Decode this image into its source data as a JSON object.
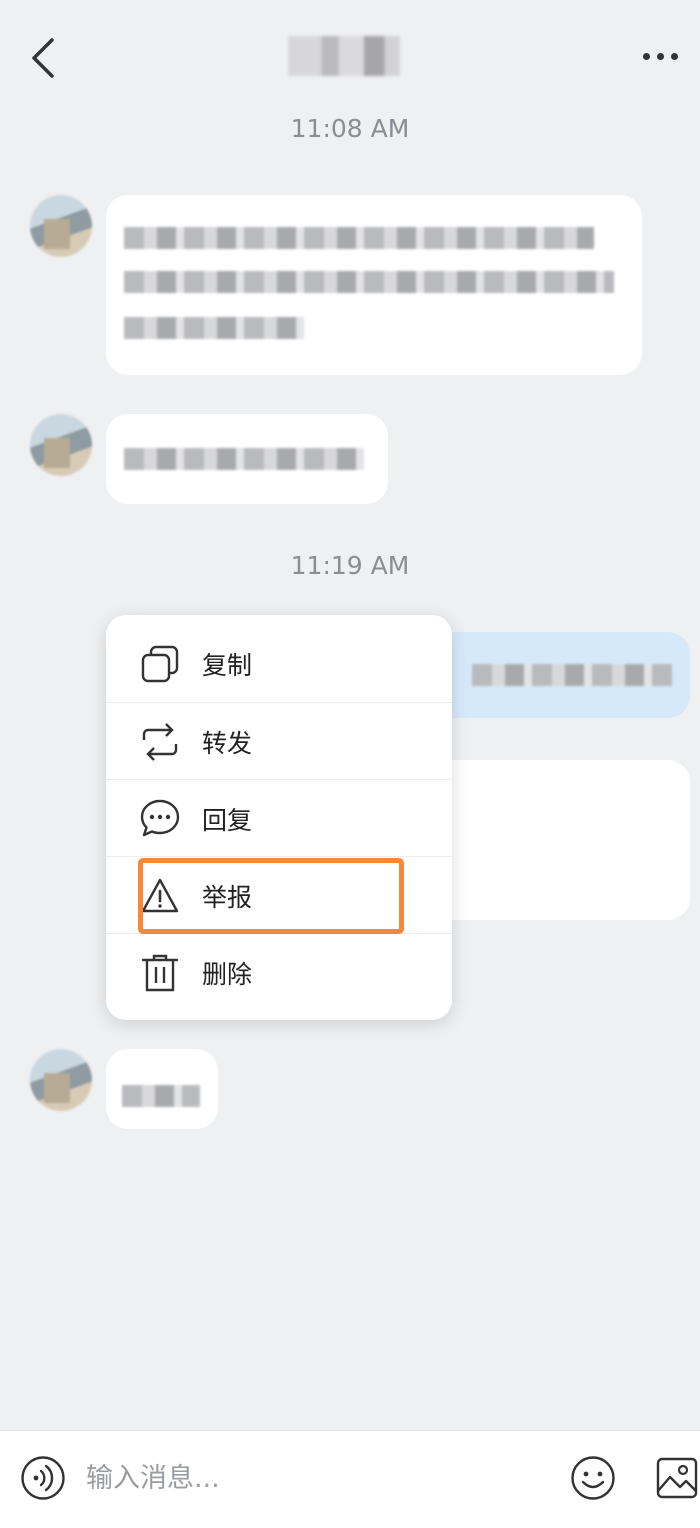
{
  "header": {
    "back_icon": "chevron-left-icon",
    "more_icon": "more-horizontal-icon"
  },
  "timestamps": [
    "11:08 AM",
    "11:19 AM"
  ],
  "context_menu": {
    "items": [
      {
        "label": "复制",
        "icon": "copy-icon"
      },
      {
        "label": "转发",
        "icon": "forward-icon"
      },
      {
        "label": "回复",
        "icon": "reply-icon"
      },
      {
        "label": "举报",
        "icon": "report-warning-icon"
      },
      {
        "label": "删除",
        "icon": "trash-icon"
      }
    ],
    "highlighted_item": "举报",
    "highlight_color": "#f5883a"
  },
  "composer": {
    "placeholder": "输入消息...",
    "voice_icon": "voice-icon",
    "emoji_icon": "emoji-icon",
    "image_icon": "image-icon"
  },
  "colors": {
    "background": "#eff0f2",
    "incoming_bubble": "#ffffff",
    "outgoing_bubble": "#d6e9fb"
  }
}
